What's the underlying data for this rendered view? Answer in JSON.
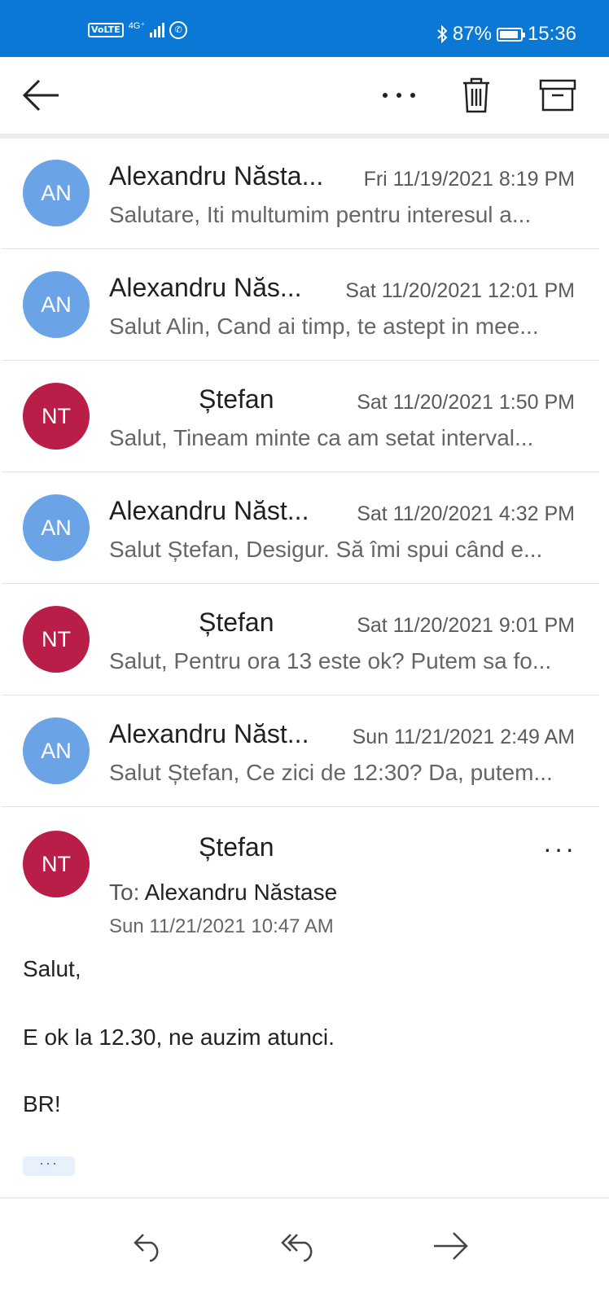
{
  "status_bar": {
    "volte": "VoLTE",
    "network": "4G⁺",
    "battery": "87%",
    "time": "15:36"
  },
  "toolbar": {
    "back_icon": "back-arrow-icon",
    "more_icon": "more-horizontal-icon",
    "delete_icon": "trash-icon",
    "archive_icon": "archive-icon"
  },
  "colors": {
    "status_bar": "#0a78d4",
    "avatar_an": "#6aa3e6",
    "avatar_nt": "#b81e48",
    "accent": "#0a78d4"
  },
  "messages": [
    {
      "initials": "AN",
      "sender": "Alexandru Năsta...",
      "date": "Fri 11/19/2021 8:19 PM",
      "preview": "Salutare, Iti multumim pentru interesul a..."
    },
    {
      "initials": "AN",
      "sender": "Alexandru Năs...",
      "date": "Sat 11/20/2021 12:01 PM",
      "preview": "Salut Alin, Cand ai timp, te astept in mee..."
    },
    {
      "initials": "NT",
      "sender": "Ștefan",
      "date": "Sat 11/20/2021 1:50 PM",
      "preview": "Salut, Tineam minte ca am setat interval..."
    },
    {
      "initials": "AN",
      "sender": "Alexandru Năst...",
      "date": "Sat 11/20/2021 4:32 PM",
      "preview": "Salut Ștefan, Desigur. Să îmi spui când e..."
    },
    {
      "initials": "NT",
      "sender": "Ștefan",
      "date": "Sat 11/20/2021 9:01 PM",
      "preview": "Salut, Pentru ora 13 este ok? Putem sa fo..."
    },
    {
      "initials": "AN",
      "sender": "Alexandru Năst...",
      "date": "Sun 11/21/2021 2:49 AM",
      "preview": "Salut Ștefan, Ce zici de 12:30? Da, putem..."
    }
  ],
  "expanded": {
    "initials": "NT",
    "sender": "Ștefan",
    "more": "···",
    "to_label": "To:",
    "to_name": "Alexandru Năstase",
    "date": "Sun 11/21/2021 10:47 AM",
    "body": [
      "Salut,",
      "E ok la 12.30, ne auzim atunci.",
      "BR!"
    ],
    "show_more": "···"
  },
  "bottom_bar": {
    "reply_icon": "reply-icon",
    "reply_all_icon": "reply-all-icon",
    "forward_icon": "forward-icon"
  }
}
